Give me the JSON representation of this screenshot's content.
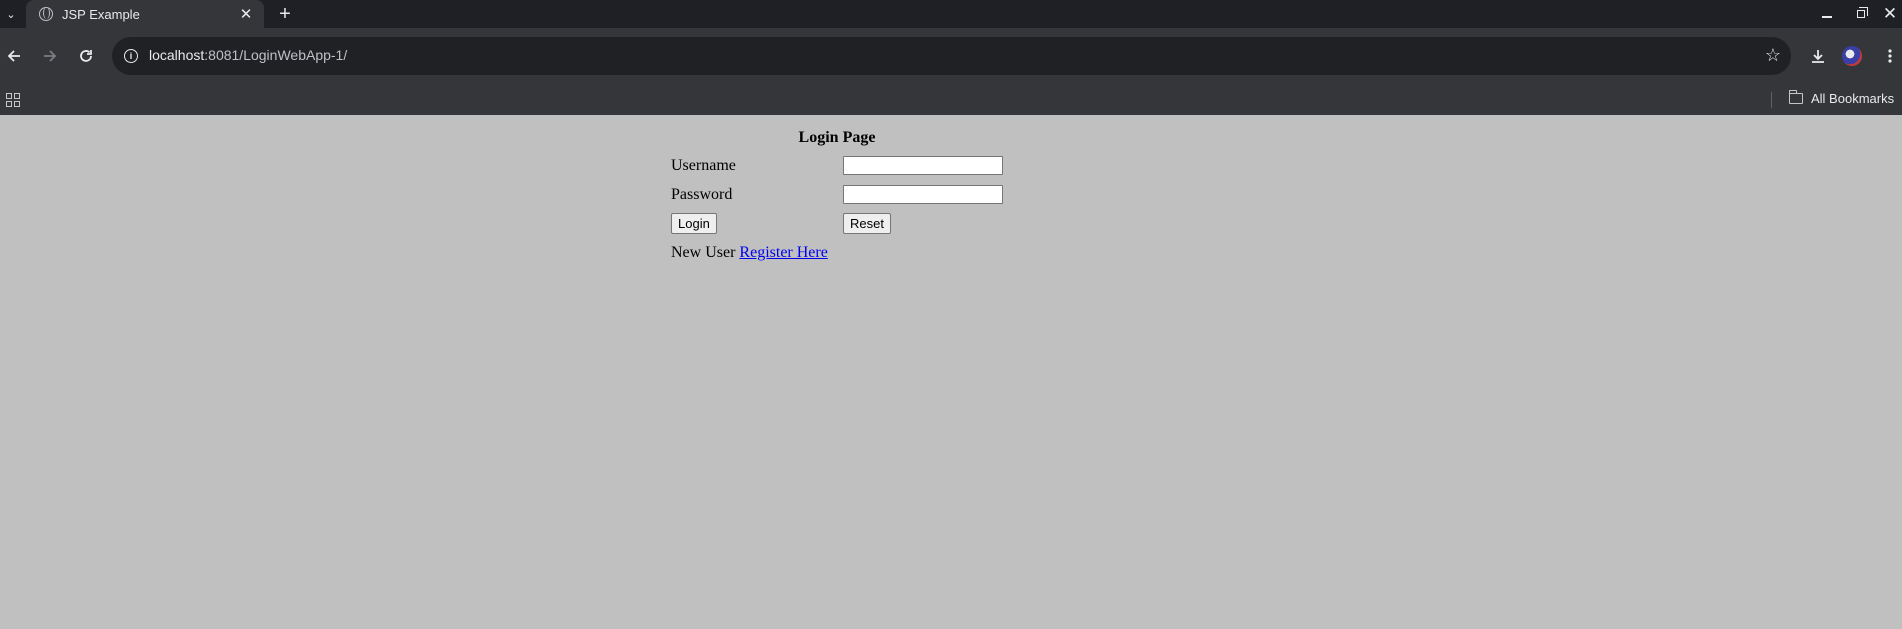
{
  "browser": {
    "tab_title": "JSP Example",
    "tab_close": "✕",
    "new_tab": "+",
    "url_host": "localhost",
    "url_path": ":8081/LoginWebApp-1/",
    "bookmarks_label": "All Bookmarks"
  },
  "page": {
    "heading": "Login Page",
    "username_label": "Username",
    "password_label": "Password",
    "username_value": "",
    "password_value": "",
    "login_button": "Login",
    "reset_button": "Reset",
    "new_user_text": "New User",
    "register_link": "Register Here"
  },
  "colors": {
    "page_background": "#c0c0c0",
    "link": "#0000ee",
    "chrome_dark": "#1e2026",
    "chrome_toolbar": "#35363a"
  }
}
